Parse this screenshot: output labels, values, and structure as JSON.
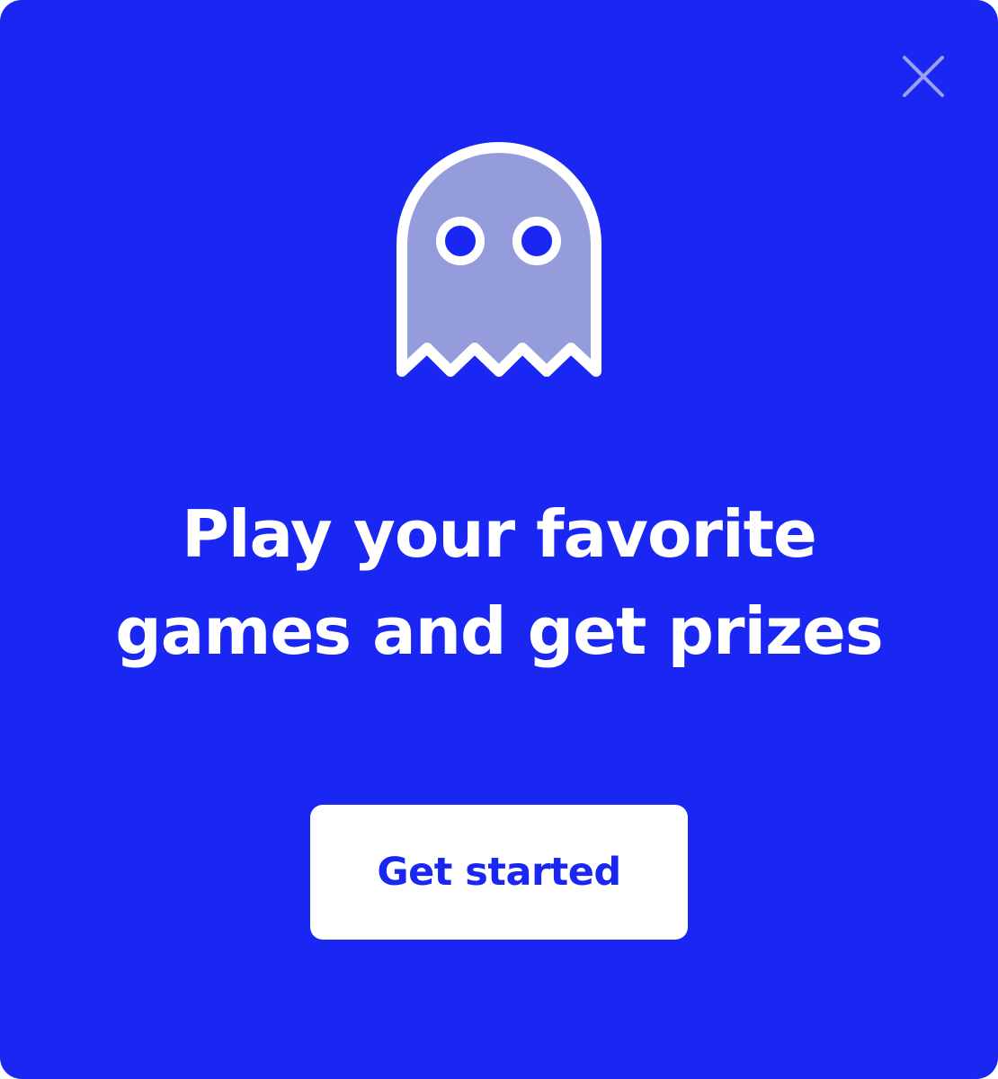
{
  "modal": {
    "background_color": "#1a26f2",
    "close_icon": "close-icon",
    "close_icon_color": "#9aa0ee",
    "illustration": {
      "icon": "ghost-icon",
      "fill_color": "#949cdc",
      "stroke_color": "#ffffff",
      "eye_color": "#1a26f2"
    },
    "headline": {
      "line1": "Play your favorite",
      "line2": "games and get prizes"
    },
    "cta": {
      "label": "Get started",
      "text_color": "#1a26f2",
      "background_color": "#ffffff"
    }
  }
}
